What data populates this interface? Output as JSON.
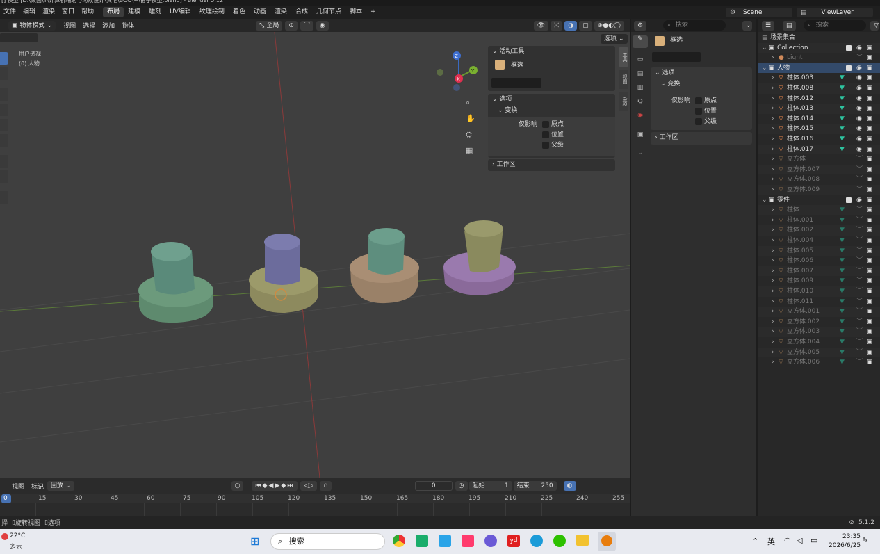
{
  "window": {
    "title": "[] 模型 [D:\\桌面\\T\\计算机辅助与动效设计\\其他\\BOO\\~\\备子模型.blend] - Blender 5.12"
  },
  "menu": [
    "文件",
    "编辑",
    "渲染",
    "窗口",
    "帮助"
  ],
  "workspaces": [
    "布局",
    "建模",
    "雕刻",
    "UV编辑",
    "纹理绘制",
    "着色",
    "动画",
    "渲染",
    "合成",
    "几何节点",
    "脚本",
    "+"
  ],
  "scene": {
    "label": "Scene",
    "view_layer": "ViewLayer"
  },
  "viewport_header": {
    "mode": "物体模式",
    "menu": [
      "视图",
      "选择",
      "添加",
      "物体"
    ],
    "transform": "全局",
    "options": "选项"
  },
  "viewport": {
    "perspective": "用户透视",
    "collection": "(0) 人物"
  },
  "gizmo": {
    "x": "X",
    "y": "Y",
    "z": "Z"
  },
  "npanel": {
    "tabs": [
      "工具",
      "视图",
      "杂项"
    ],
    "active_tool_title": "活动工具",
    "active_tool": "框选",
    "options_title": "选项",
    "transform_title": "变换",
    "affect_only": "仅影响",
    "origin": "原点",
    "location": "位置",
    "parents": "父级",
    "workspace_title": "工作区"
  },
  "properties": {
    "search_placeholder": "搜索",
    "tool_name": "框选",
    "options_title": "选项",
    "transform_title": "变换",
    "affect_only": "仅影响",
    "origin": "原点",
    "location": "位置",
    "parents": "父级",
    "workspace_title": "工作区"
  },
  "outliner": {
    "search_placeholder": "搜索",
    "scene_collection": "场景集合",
    "collection": "Collection",
    "light": "Light",
    "people": "人物",
    "people_items": [
      "柱体.003",
      "柱体.008",
      "柱体.012",
      "柱体.013",
      "柱体.014",
      "柱体.015",
      "柱体.016",
      "柱体.017"
    ],
    "people_hidden": [
      "立方体",
      "立方体.007",
      "立方体.008",
      "立方体.009"
    ],
    "parts": "零件",
    "parts_items": [
      "柱体",
      "柱体.001",
      "柱体.002",
      "柱体.004",
      "柱体.005",
      "柱体.006",
      "柱体.007",
      "柱体.009",
      "柱体.010",
      "柱体.011",
      "立方体.001",
      "立方体.002",
      "立方体.003",
      "立方体.004",
      "立方体.005",
      "立方体.006"
    ]
  },
  "timeline": {
    "menu": [
      "视图",
      "标记"
    ],
    "playback": "回放",
    "current_frame": "0",
    "start_label": "起始",
    "start": "1",
    "end_label": "结束",
    "end": "250",
    "ticks": [
      "0",
      "15",
      "30",
      "45",
      "60",
      "75",
      "90",
      "105",
      "120",
      "135",
      "150",
      "165",
      "180",
      "195",
      "210",
      "225",
      "240",
      "255"
    ]
  },
  "statusbar": {
    "left1": "择",
    "left2": "旋转视图",
    "left3": "选项",
    "version": "5.1.2"
  },
  "taskbar": {
    "weather_temp": "22°C",
    "weather_text": "多云",
    "search": "搜索",
    "ime": "英",
    "time": "23:35",
    "date": "2026/6/25"
  },
  "colors": {
    "accent": "#4772b3",
    "bg": "#3f3f3f",
    "panel": "#303030"
  }
}
